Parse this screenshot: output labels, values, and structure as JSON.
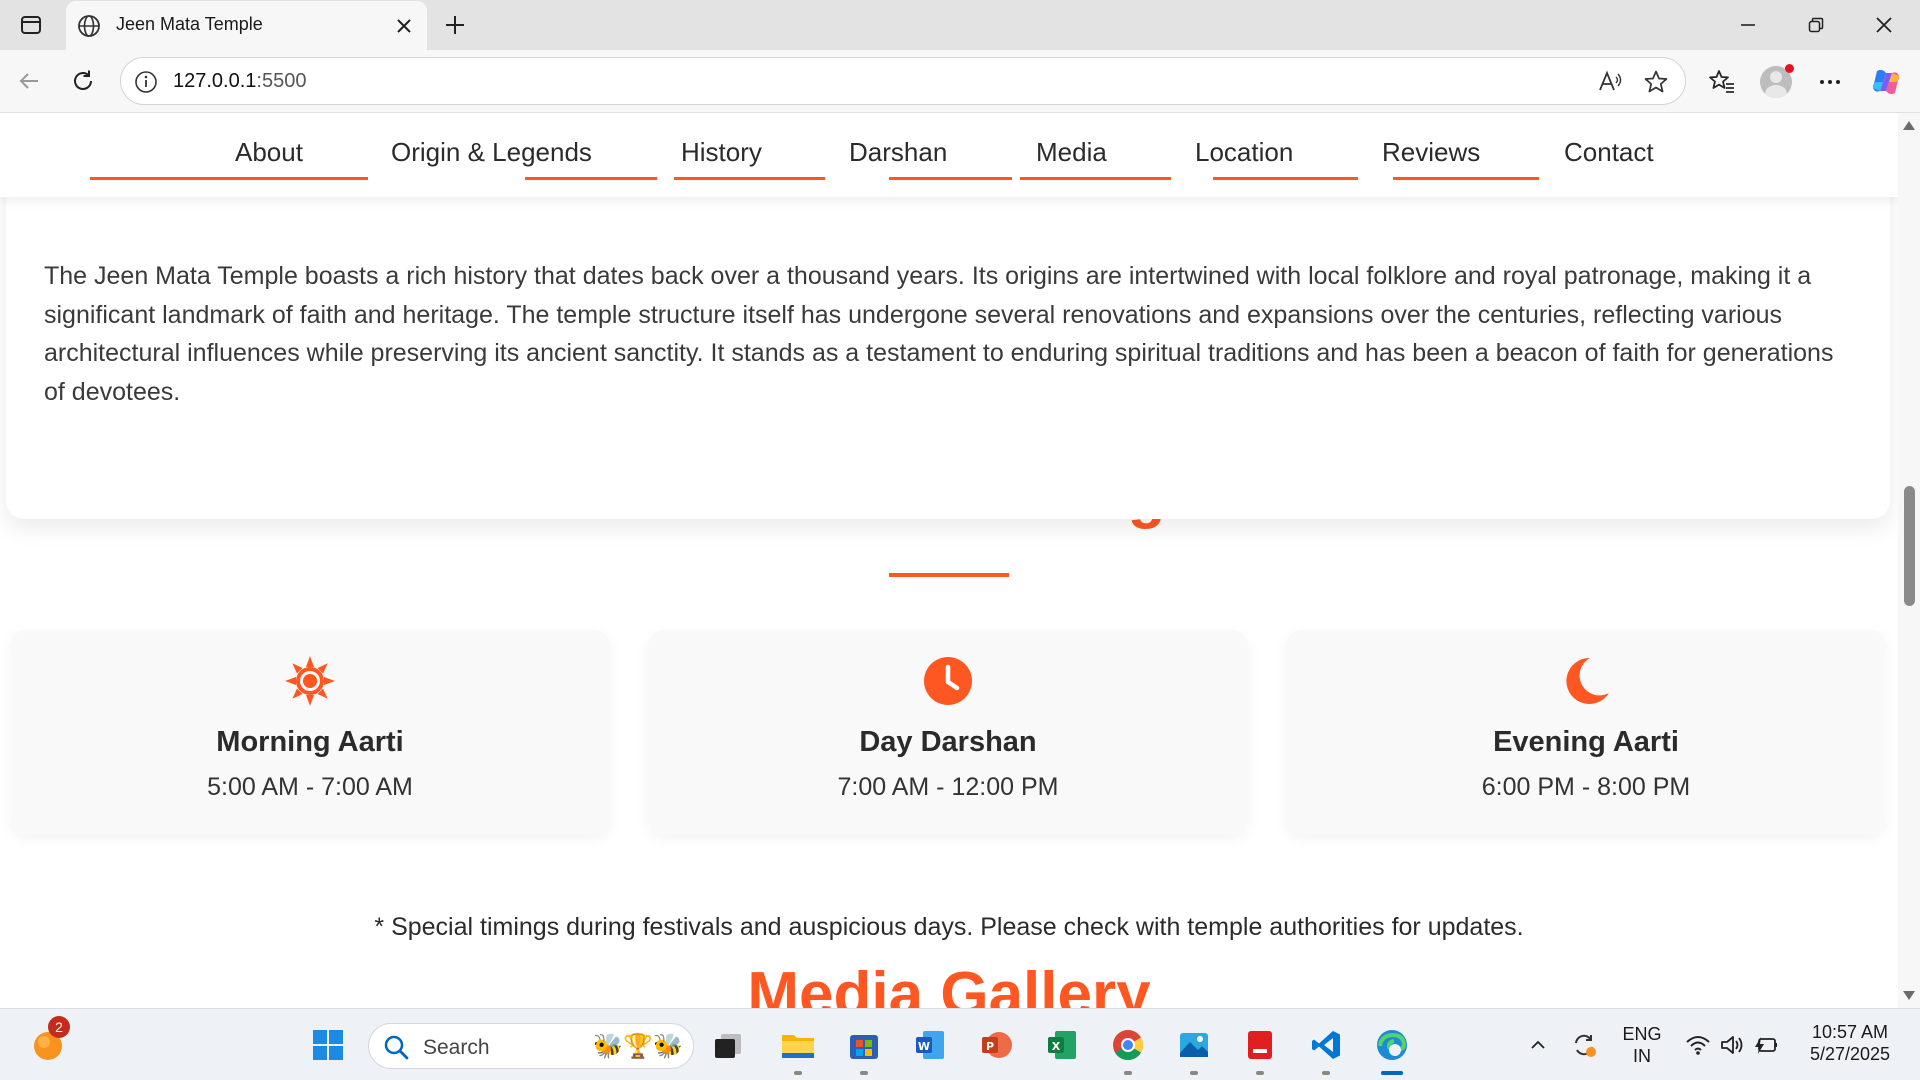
{
  "browser": {
    "tab_title": "Jeen Mata Temple",
    "url_host": "127.0.0.1",
    "url_port": ":5500"
  },
  "site_nav": {
    "items": [
      "About",
      "Origin & Legends",
      "History",
      "Darshan",
      "Media",
      "Location",
      "Reviews",
      "Contact"
    ]
  },
  "history": {
    "paragraph": "The Jeen Mata Temple boasts a rich history that dates back over a thousand years. Its origins are intertwined with local folklore and royal patronage, making it a significant landmark of faith and heritage. The temple structure itself has undergone several renovations and expansions over the centuries, reflecting various architectural influences while preserving its ancient sanctity. It stands as a testament to enduring spiritual traditions and has been a beacon of faith for generations of devotees."
  },
  "darshan": {
    "title": "Darshan Timings",
    "cards": [
      {
        "icon": "sun-icon",
        "name": "Morning Aarti",
        "time": "5:00 AM - 7:00 AM"
      },
      {
        "icon": "clock-icon",
        "name": "Day Darshan",
        "time": "7:00 AM - 12:00 PM"
      },
      {
        "icon": "moon-icon",
        "name": "Evening Aarti",
        "time": "6:00 PM - 8:00 PM"
      }
    ],
    "note": "* Special timings during festivals and auspicious days. Please check with temple authorities for updates."
  },
  "media": {
    "title": "Media Gallery"
  },
  "taskbar": {
    "notification_count": "2",
    "search_placeholder": "Search",
    "lang_line1": "ENG",
    "lang_line2": "IN",
    "time": "10:57 AM",
    "date": "5/27/2025"
  },
  "colors": {
    "accent": "#ff5722",
    "text_dark": "#2b2b2b"
  }
}
